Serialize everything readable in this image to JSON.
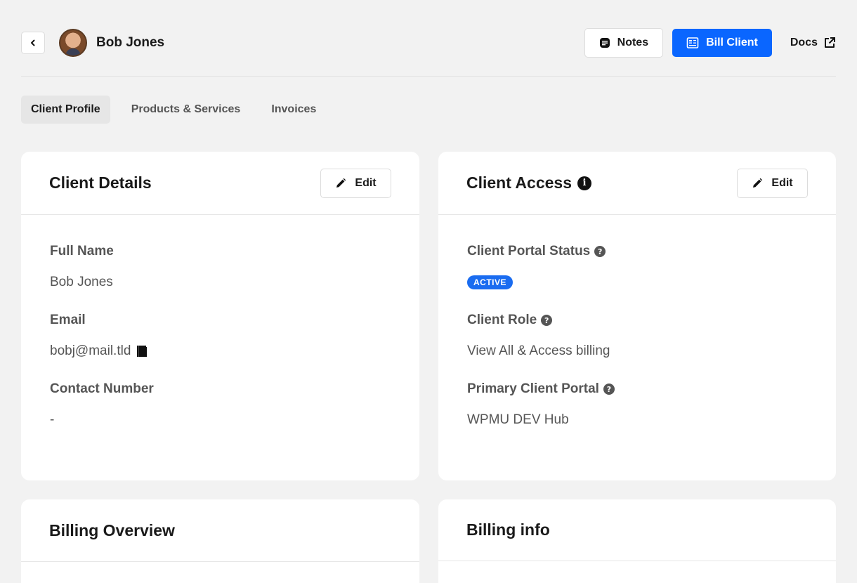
{
  "header": {
    "client_name": "Bob Jones",
    "notes_label": "Notes",
    "bill_label": "Bill Client",
    "docs_label": "Docs"
  },
  "tabs": [
    {
      "label": "Client Profile",
      "active": true
    },
    {
      "label": "Products & Services",
      "active": false
    },
    {
      "label": "Invoices",
      "active": false
    }
  ],
  "client_details": {
    "title": "Client Details",
    "edit_label": "Edit",
    "full_name_label": "Full Name",
    "full_name_value": "Bob Jones",
    "email_label": "Email",
    "email_value": "bobj@mail.tld",
    "contact_label": "Contact Number",
    "contact_value": "-"
  },
  "client_access": {
    "title": "Client Access",
    "edit_label": "Edit",
    "portal_status_label": "Client Portal Status",
    "portal_status_value": "ACTIVE",
    "role_label": "Client Role",
    "role_value": "View All & Access billing",
    "primary_portal_label": "Primary Client Portal",
    "primary_portal_value": "WPMU DEV Hub"
  },
  "billing_overview": {
    "title": "Billing Overview"
  },
  "billing_info": {
    "title": "Billing info"
  },
  "colors": {
    "primary": "#0a66ff",
    "badge_active": "#1a6cf0",
    "background": "#f2f2f2"
  },
  "icons": {
    "back": "chevron-left-icon",
    "notes": "notes-icon",
    "bill": "invoice-icon",
    "docs": "external-link-icon",
    "edit": "pencil-icon",
    "info": "info-icon",
    "help": "help-icon",
    "copy": "copy-icon"
  }
}
